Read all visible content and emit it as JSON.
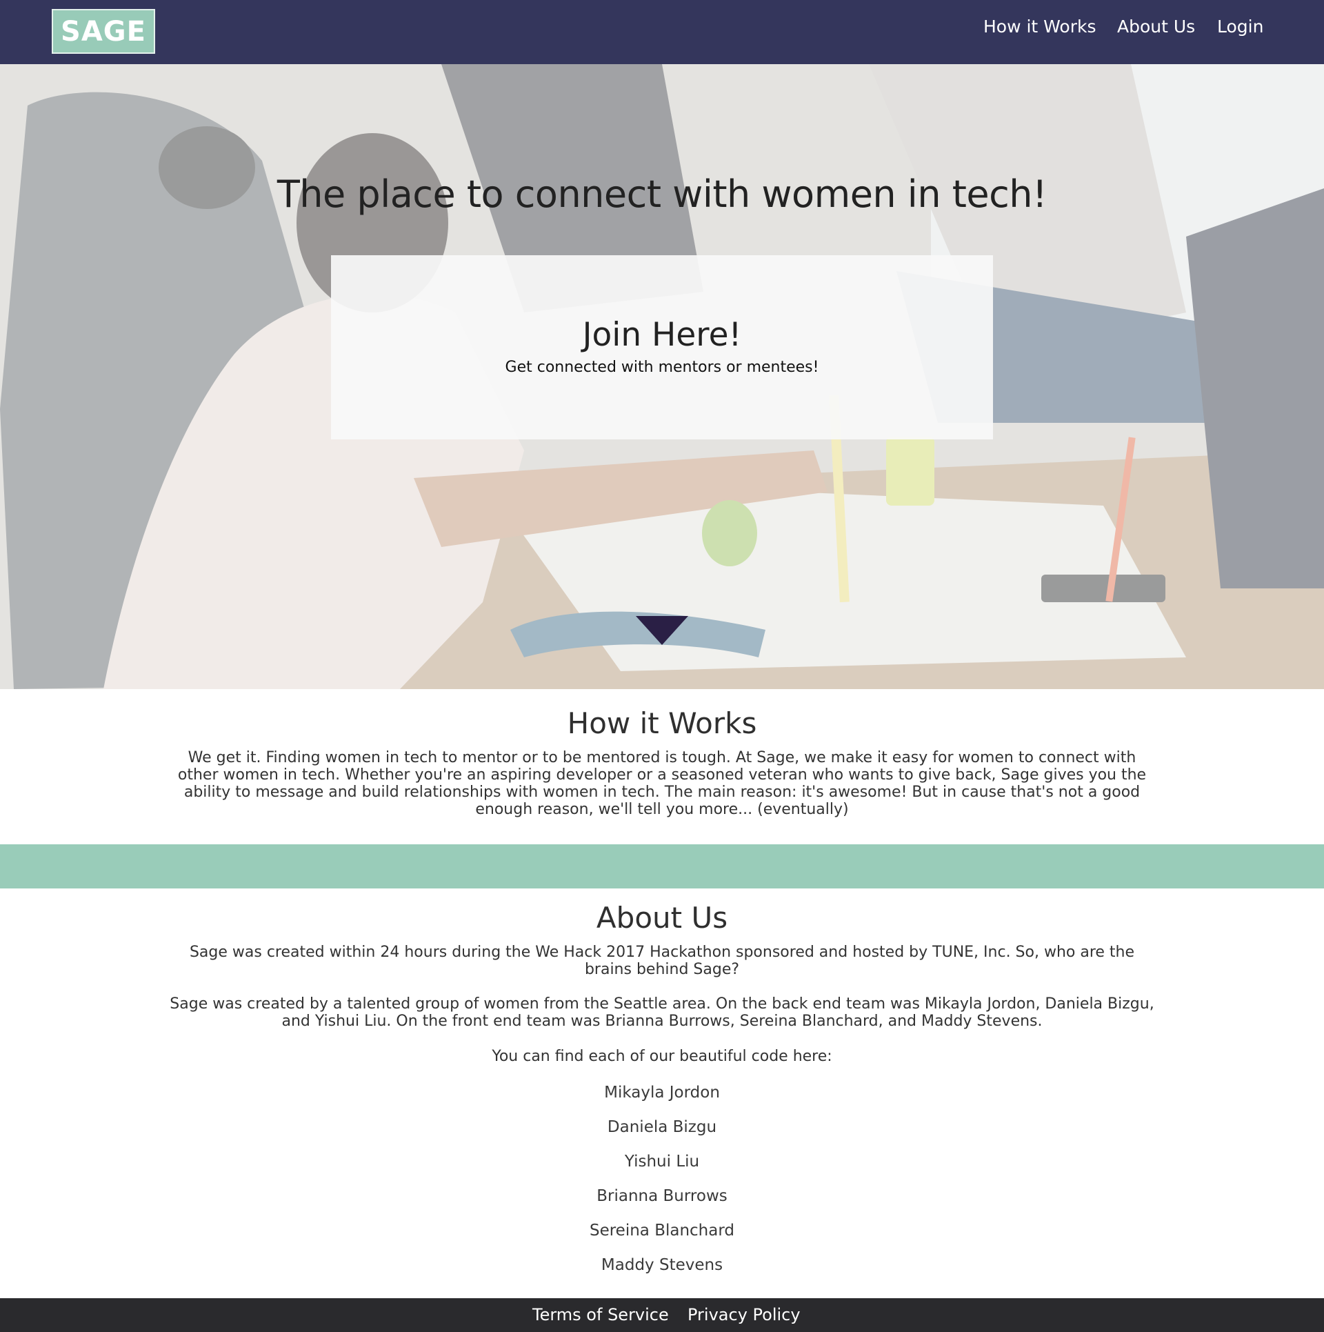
{
  "colors": {
    "nav_bg": "#34365c",
    "logo_bg": "#98cbb8",
    "divider": "#99ccb9",
    "footer_bg": "#2a2a2d",
    "arrow": "#2a1f45"
  },
  "nav": {
    "logo": "SAGE",
    "links": [
      "How it Works",
      "About Us",
      "Login"
    ]
  },
  "hero": {
    "title": "The place to connect with women in tech!",
    "join_title": "Join Here!",
    "join_subtitle": "Get connected with mentors or mentees!",
    "arrow_icon": "chevron-down-icon"
  },
  "how_it_works": {
    "title": "How it Works",
    "text": "We get it. Finding women in tech to mentor or to be mentored is tough. At Sage, we make it easy for women to connect with other women in tech. Whether you're an aspiring developer or a seasoned veteran who wants to give back, Sage gives you the ability to message and build relationships with women in tech. The main reason: it's awesome! But in cause that's not a good enough reason, we'll tell you more... (eventually)"
  },
  "about": {
    "title": "About Us",
    "p1": "Sage was created within 24 hours during the We Hack 2017 Hackathon sponsored and hosted by TUNE, Inc. So, who are the brains behind Sage?",
    "p2": "Sage was created by a talented group of women from the Seattle area. On the back end team was Mikayla Jordon, Daniela Bizgu, and Yishui Liu. On the front end team was Brianna Burrows, Sereina Blanchard, and Maddy Stevens.",
    "p3": "You can find each of our beautiful code here:",
    "members": [
      "Mikayla Jordon",
      "Daniela Bizgu",
      "Yishui Liu",
      "Brianna Burrows",
      "Sereina Blanchard",
      "Maddy Stevens"
    ]
  },
  "footer": {
    "links": [
      "Terms of Service",
      "Privacy Policy"
    ]
  }
}
